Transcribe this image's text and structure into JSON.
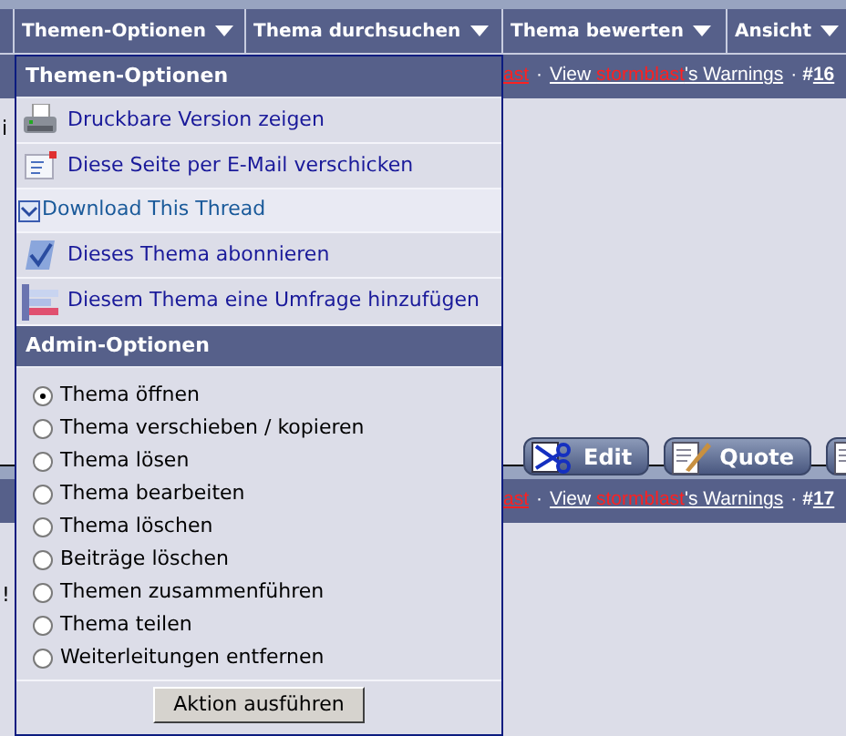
{
  "nav": {
    "tabs": [
      {
        "label": "Themen-Optionen"
      },
      {
        "label": "Thema durchsuchen"
      },
      {
        "label": "Thema bewerten"
      },
      {
        "label": "Ansicht"
      }
    ]
  },
  "posts": [
    {
      "left_text": "i",
      "header": {
        "user_fragment": "ast",
        "separator": "·",
        "warnings_prefix": "View ",
        "warnings_user": "stormblast",
        "warnings_suffix": "'s Warnings",
        "number_prefix": "#",
        "number": "16"
      },
      "buttons": [
        {
          "kind": "edit",
          "label": "Edit"
        },
        {
          "kind": "quote",
          "label": "Quote"
        },
        {
          "kind": "reply"
        }
      ]
    },
    {
      "left_text": "!",
      "header": {
        "user_fragment": "ast",
        "separator": "·",
        "warnings_prefix": "View ",
        "warnings_user": "stormblast",
        "warnings_suffix": "'s Warnings",
        "number_prefix": "#",
        "number": "17"
      }
    }
  ],
  "menu": {
    "title": "Themen-Optionen",
    "items": [
      {
        "kind": "printer",
        "label": "Druckbare Version zeigen",
        "highlighted": false
      },
      {
        "kind": "email",
        "label": "Diese Seite per E-Mail verschicken",
        "highlighted": false
      },
      {
        "kind": "download",
        "label": "Download This Thread",
        "highlighted": true
      },
      {
        "kind": "subscribe",
        "label": "Dieses Thema abonnieren",
        "highlighted": false
      },
      {
        "kind": "poll",
        "label": "Diesem Thema eine Umfrage hinzufügen",
        "highlighted": false
      }
    ],
    "admin_title": "Admin-Optionen",
    "admin_options": [
      {
        "label": "Thema öffnen",
        "selected": true
      },
      {
        "label": "Thema verschieben / kopieren",
        "selected": false
      },
      {
        "label": "Thema lösen",
        "selected": false
      },
      {
        "label": "Thema bearbeiten",
        "selected": false
      },
      {
        "label": "Thema löschen",
        "selected": false
      },
      {
        "label": "Beiträge löschen",
        "selected": false
      },
      {
        "label": "Themen zusammenführen",
        "selected": false
      },
      {
        "label": "Thema teilen",
        "selected": false
      },
      {
        "label": "Weiterleitungen entfernen",
        "selected": false
      }
    ],
    "submit": "Aktion ausführen"
  }
}
